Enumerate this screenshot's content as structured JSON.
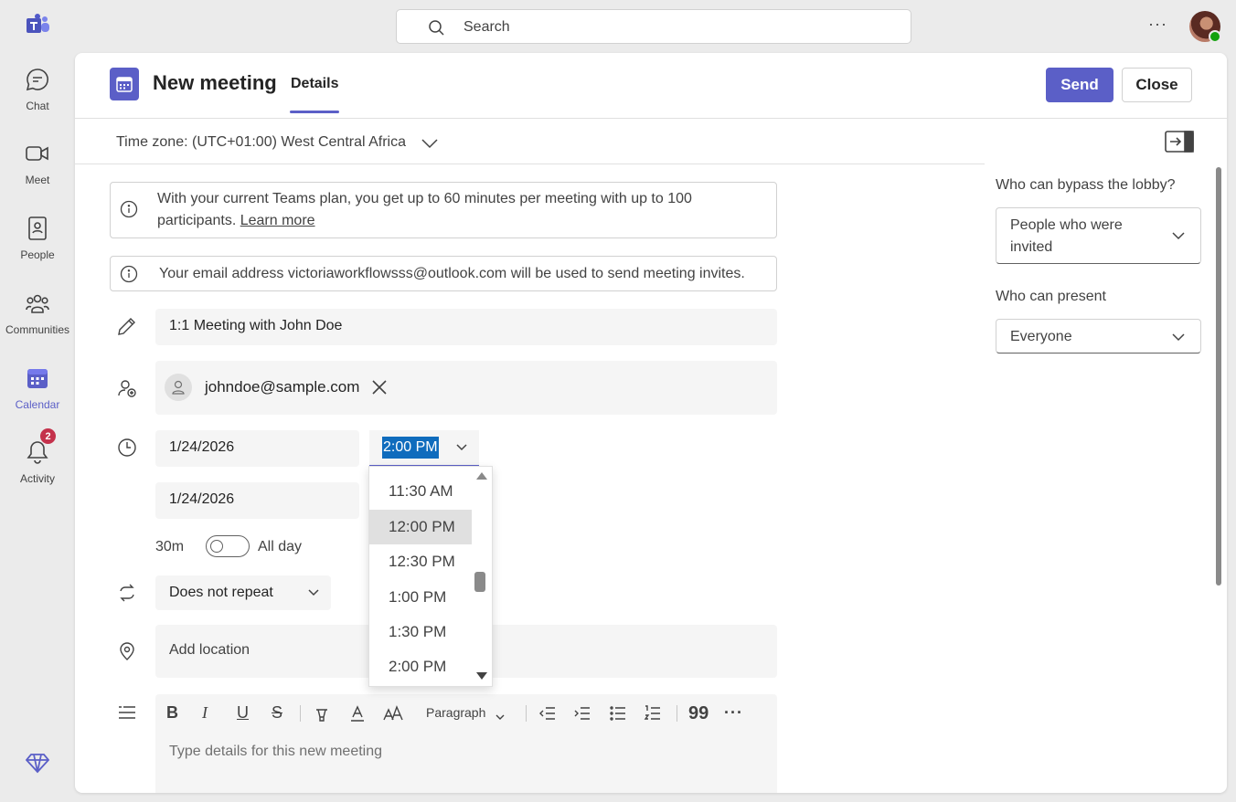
{
  "rail": {
    "items": [
      {
        "label": "Chat",
        "icon": "chat-icon"
      },
      {
        "label": "Meet",
        "icon": "video-camera-icon"
      },
      {
        "label": "People",
        "icon": "contact-book-icon"
      },
      {
        "label": "Communities",
        "icon": "people-group-icon"
      },
      {
        "label": "Calendar",
        "icon": "calendar-icon",
        "active": true
      },
      {
        "label": "Activity",
        "icon": "bell-icon",
        "badge": "2"
      }
    ]
  },
  "search": {
    "placeholder": "Search"
  },
  "header": {
    "title": "New meeting",
    "tab": "Details",
    "send_label": "Send",
    "close_label": "Close"
  },
  "timezone": {
    "label": "Time zone: (UTC+01:00) West Central Africa"
  },
  "notices": {
    "plan_text": "With your current Teams plan, you get up to 60 minutes per meeting with up to 100 participants.",
    "plan_link": "Learn more",
    "email_text": "Your email address victoriaworkflowsss@outlook.com will be used to send meeting invites."
  },
  "meeting": {
    "title_value": "1:1 Meeting with John Doe",
    "attendee": "johndoe@sample.com",
    "start_date": "1/24/2026",
    "start_time": "2:00 PM",
    "end_date": "1/24/2026",
    "duration": "30m",
    "all_day_label": "All day",
    "all_day": false,
    "repeat": "Does not repeat",
    "location_placeholder": "Add location",
    "details_placeholder": "Type details for this new meeting",
    "paragraph_style": "Paragraph"
  },
  "time_dropdown": {
    "options": [
      "11:30 AM",
      "12:00 PM",
      "12:30 PM",
      "1:00 PM",
      "1:30 PM",
      "2:00 PM"
    ],
    "hovered": "12:00 PM"
  },
  "options_panel": {
    "lobby_label": "Who can bypass the lobby?",
    "lobby_value_line1": "People who were",
    "lobby_value_line2": "invited",
    "present_label": "Who can present",
    "present_value": "Everyone"
  },
  "colors": {
    "accent": "#5b5fc7",
    "selection": "#0f6cbd",
    "badge": "#c4314b",
    "presence": "#13a10e"
  }
}
